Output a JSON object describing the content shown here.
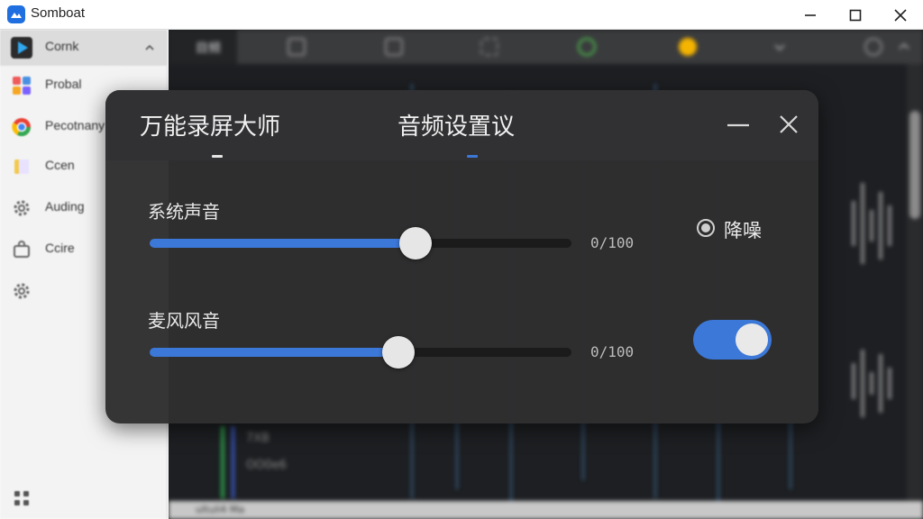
{
  "window": {
    "title": "Somboat",
    "controls": {
      "minimize": "—",
      "maximize": "☐",
      "close": "✕"
    }
  },
  "sidebar": {
    "items": [
      {
        "label": "Cornk",
        "icon": "play-icon",
        "active": true
      },
      {
        "label": "Probal",
        "icon": "app-tiles-icon",
        "active": false
      },
      {
        "label": "Pecotnany",
        "icon": "browser-icon",
        "active": false
      },
      {
        "label": "Ccen",
        "icon": "folder-icon",
        "active": false
      },
      {
        "label": "Auding",
        "icon": "gear-icon",
        "active": false
      },
      {
        "label": "Ccire",
        "icon": "bag-icon",
        "active": false
      },
      {
        "label": "",
        "icon": "gear-icon",
        "active": false
      }
    ]
  },
  "editor": {
    "active_tab": "目频",
    "statusbar_text": "ultuli4 Ma",
    "track_labels": [
      "7XB",
      "OO0e6"
    ]
  },
  "dialog": {
    "tabs": [
      {
        "label": "万能录屏大师",
        "indicator_color": "#e6e6e6"
      },
      {
        "label": "音频设置议",
        "indicator_color": "#3c78d8"
      }
    ],
    "system_audio": {
      "label": "系统声音",
      "value_text": "0/100",
      "level": 0.63
    },
    "mic_audio": {
      "label": "麦风风音",
      "value_text": "0/100",
      "level": 0.59
    },
    "noise_reduction": {
      "label": "降噪",
      "checked": true
    },
    "mic_toggle": {
      "on": true
    },
    "accent_color": "#3c78d8"
  }
}
